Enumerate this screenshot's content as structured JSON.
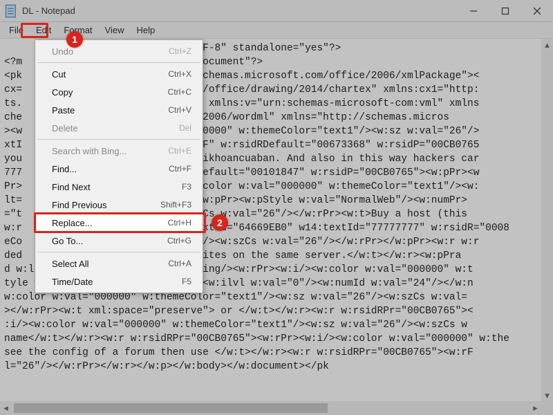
{
  "window": {
    "title": "DL - Notepad"
  },
  "menubar": {
    "items": [
      {
        "label": "File"
      },
      {
        "label": "Edit"
      },
      {
        "label": "Format"
      },
      {
        "label": "View"
      },
      {
        "label": "Help"
      }
    ]
  },
  "edit_menu": {
    "undo": {
      "label": "Undo",
      "accel": "Ctrl+Z",
      "disabled": true
    },
    "cut": {
      "label": "Cut",
      "accel": "Ctrl+X"
    },
    "copy": {
      "label": "Copy",
      "accel": "Ctrl+C"
    },
    "paste": {
      "label": "Paste",
      "accel": "Ctrl+V"
    },
    "delete": {
      "label": "Delete",
      "accel": "Del",
      "disabled": true
    },
    "bing": {
      "label": "Search with Bing...",
      "accel": "Ctrl+E",
      "disabled": true
    },
    "find": {
      "label": "Find...",
      "accel": "Ctrl+F"
    },
    "find_next": {
      "label": "Find Next",
      "accel": "F3"
    },
    "find_prev": {
      "label": "Find Previous",
      "accel": "Shift+F3"
    },
    "replace": {
      "label": "Replace...",
      "accel": "Ctrl+H"
    },
    "goto": {
      "label": "Go To...",
      "accel": "Ctrl+G"
    },
    "select_all": {
      "label": "Select All",
      "accel": "Ctrl+A"
    },
    "time_date": {
      "label": "Time/Date",
      "accel": "F5"
    }
  },
  "annotations": {
    "badge1": "1",
    "badge2": "2"
  },
  "editor_lines": [
    "                              \"UTF-8\" standalone=\"yes\"?>",
    "<?m                           d.Document\"?>",
    "<pk                           //schemas.microsoft.com/office/2006/xmlPackage\"><",
    "cx=                           com/office/drawing/2014/chartex\" xmlns:cx1=\"http:",
    "ts.                           th\" xmlns:v=\"urn:schemas-microsoft-com:vml\" xmlns",
    "che                           rd/2006/wordml\" xmlns=\"http://schemas.micros",
    "><w                           \"000000\" w:themeColor=\"text1\"/><w:sz w:val=\"26\"/>",
    "xtI                           7D6F\" w:rsidRDefault=\"00673368\" w:rsidP=\"00CB0765",
    "you                           /taikhoancuaban. And also in this way hackers car",
    "777                           dRDefault=\"00101847\" w:rsidP=\"00CB0765\"><w:pPr><w",
    "Pr>                           <w:color w:val=\"000000\" w:themeColor=\"text1\"/><w:",
    "lt=                           \"><w:pPr><w:pStyle w:val=\"NormalWeb\"/><w:numPr>",
    "=\"t                           :szCs w:val=\"26\"/></w:rPr><w:t>Buy a host (this",
    "w:r                           :textId=\"64669EB0\" w14:textId=\"77777777\" w:rsidR=\"0008",
    "eCo                           26\"/><w:szCs w:val=\"26\"/></w:rPr></w:pPr><w:r w:r",
    "ded                           ebsites on the same server.</w:t></w:r><w:pPra",
    "d w:left=\"720\"/><w:contextualSpacing/><w:rPr><w:i/><w:color w:val=\"000000\" w:t",
    "tyle w:val=\"NormalWeb\"/><w:numPr><w:ilvl w:val=\"0\"/><w:numId w:val=\"24\"/></w:n",
    "w:color w:val=\"000000\" w:themeColor=\"text1\"/><w:sz w:val=\"26\"/><w:szCs w:val=",
    "></w:rPr><w:t xml:space=\"preserve\"> or </w:t></w:r><w:r w:rsidRPr=\"00CB0765\"><",
    ":i/><w:color w:val=\"000000\" w:themeColor=\"text1\"/><w:sz w:val=\"26\"/><w:szCs w",
    "name</w:t></w:r><w:r w:rsidRPr=\"00CB0765\"><w:rPr><w:i/><w:color w:val=\"000000\" w:the",
    "see the config of a forum then use </w:t></w:r><w:r w:rsidRPr=\"00CB0765\"><w:rF",
    "l=\"26\"/></w:rPr></w:r></w:p></w:body></w:document></pk"
  ]
}
